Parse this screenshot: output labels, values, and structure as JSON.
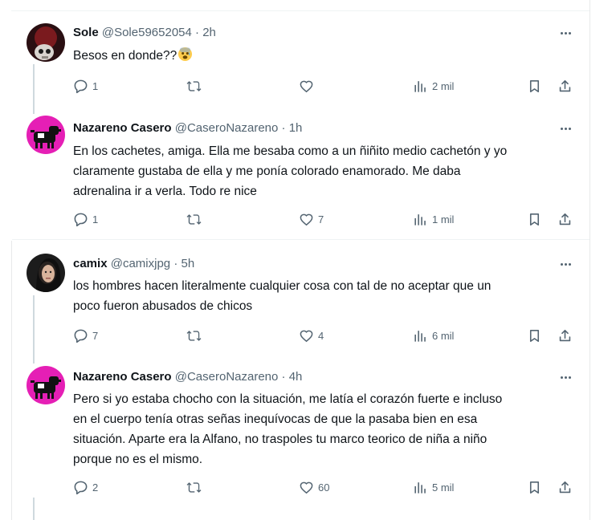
{
  "separator": "·",
  "tweets": [
    {
      "name": "Sole",
      "handle": "@Sole59652054",
      "time": "2h",
      "text": "Besos en donde??",
      "emoji": "anxious-face-emoji",
      "replies": "1",
      "retweets": "",
      "likes": "",
      "views": "2 mil"
    },
    {
      "name": "Nazareno Casero",
      "handle": "@CaseroNazareno",
      "time": "1h",
      "text": "En los cachetes, amiga. Ella me besaba como a un ñiñito medio cachetón y yo\nclaramente gustaba de ella y me ponía colorado enamorado. Me daba\nadrenalina ir a verla. Todo re nice",
      "replies": "1",
      "retweets": "",
      "likes": "7",
      "views": "1 mil"
    },
    {
      "name": "camix",
      "handle": "@camixjpg",
      "time": "5h",
      "text": "los hombres hacen literalmente cualquier cosa con tal de no aceptar que un\npoco fueron abusados de chicos",
      "replies": "7",
      "retweets": "",
      "likes": "4",
      "views": "6 mil"
    },
    {
      "name": "Nazareno Casero",
      "handle": "@CaseroNazareno",
      "time": "4h",
      "text": "Pero si yo estaba chocho con la situación, me latía el corazón fuerte e incluso\nen el cuerpo tenía otras señas inequívocas de que la pasaba bien en esa\nsituación. Aparte era la Alfano, no traspoles tu marco teorico de niña a niño\nporque no es el mismo.",
      "replies": "2",
      "retweets": "",
      "likes": "60",
      "views": "5 mil"
    }
  ],
  "colors": {
    "muted": "#536471",
    "text": "#0f1419",
    "divider": "#eff3f4",
    "avatar_magenta": "#e51fb5"
  }
}
